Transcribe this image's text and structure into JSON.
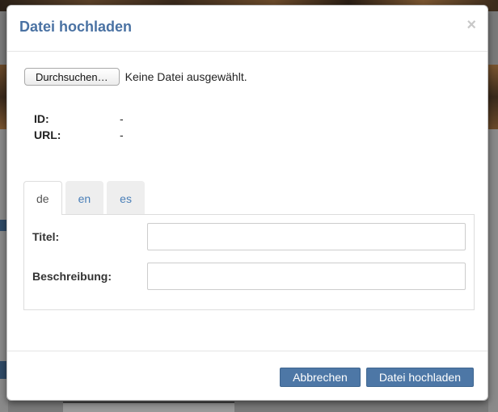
{
  "dialog": {
    "title": "Datei hochladen",
    "close_glyph": "×"
  },
  "file_input": {
    "button_label": "Durchsuchen…",
    "status_text": "Keine Datei ausgewählt."
  },
  "meta": [
    {
      "key": "ID:",
      "value": "-"
    },
    {
      "key": "URL:",
      "value": "-"
    }
  ],
  "tabs": [
    {
      "label": "de",
      "active": true
    },
    {
      "label": "en",
      "active": false
    },
    {
      "label": "es",
      "active": false
    }
  ],
  "form": {
    "title_label": "Titel:",
    "title_value": "",
    "description_label": "Beschreibung:",
    "description_value": ""
  },
  "footer": {
    "cancel_label": "Abbrechen",
    "submit_label": "Datei hochladen"
  },
  "colors": {
    "accent": "#4a72a3",
    "button": "#4d77a6",
    "link": "#4a7fb8",
    "overlay": "#7a7a7a"
  }
}
